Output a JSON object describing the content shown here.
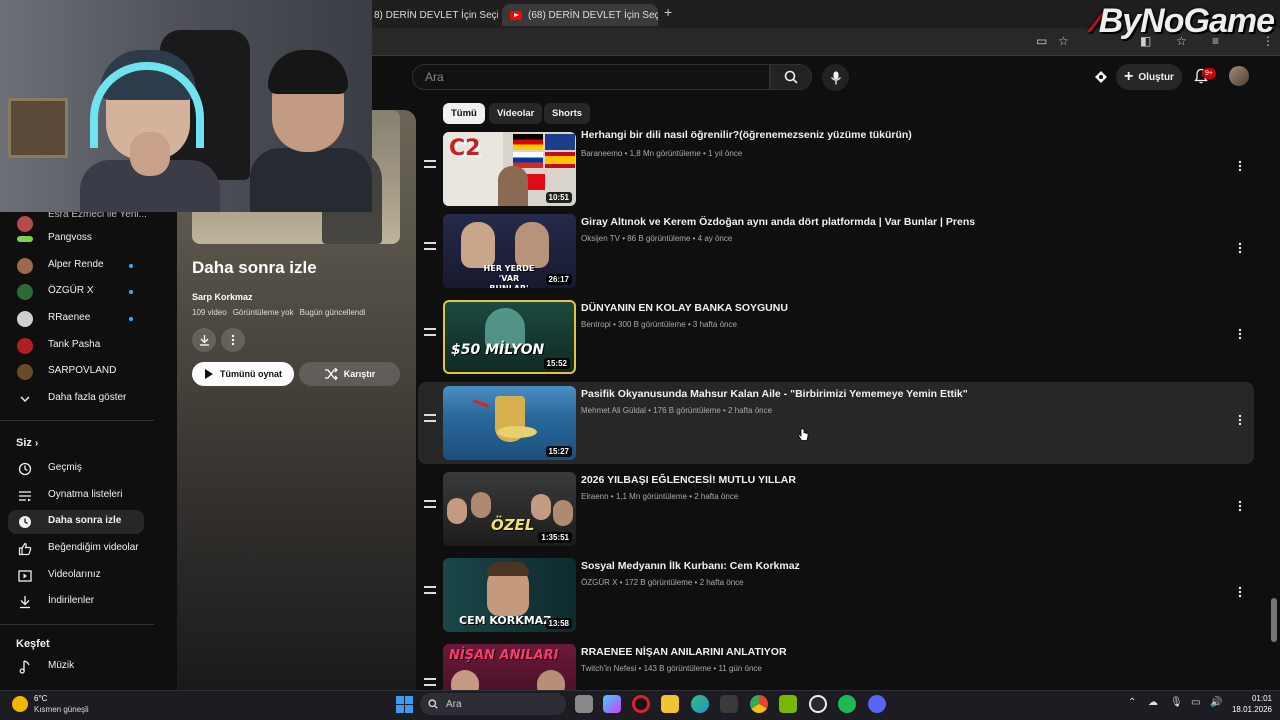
{
  "browser": {
    "tabs": [
      {
        "title": "8) DERİN DEVLET İçin Seçilse",
        "close": "✕"
      },
      {
        "title": "(68) DERİN DEVLET İçin Seçilse",
        "close": "✕"
      }
    ],
    "new_tab": "+"
  },
  "watermark": {
    "prefix": "By",
    "name": "NoGame"
  },
  "header": {
    "search_placeholder": "Ara",
    "create_label": "Oluştur",
    "notifications_count": "9+"
  },
  "sidebar": {
    "subscriptions": [
      {
        "label": "Esra Ezmeci ile Yeni...",
        "color": "#b84a4a",
        "dot": false
      },
      {
        "label": "Pangvoss",
        "color": "#7fd14a",
        "dot": false
      },
      {
        "label": "Alper Rende",
        "color": "#9a6a4a",
        "dot": true
      },
      {
        "label": "ÖZGÜR X",
        "color": "#2b6b3a",
        "dot": true
      },
      {
        "label": "RRaenee",
        "color": "#cfcfcf",
        "dot": true
      },
      {
        "label": "Tank Pasha",
        "color": "#b02020",
        "dot": false
      },
      {
        "label": "SARPOVLAND",
        "color": "#6b4a2a",
        "dot": false
      }
    ],
    "show_more": "Daha fazla göster",
    "you_header": "Siz",
    "you_items": [
      {
        "label": "Geçmiş",
        "icon": "history-icon"
      },
      {
        "label": "Oynatma listeleri",
        "icon": "playlists-icon"
      },
      {
        "label": "Daha sonra izle",
        "icon": "watch-later-icon"
      },
      {
        "label": "Beğendiğim videolar",
        "icon": "thumbs-up-icon"
      },
      {
        "label": "Videolarınız",
        "icon": "your-videos-icon"
      },
      {
        "label": "İndirilenler",
        "icon": "downloads-icon"
      }
    ],
    "explore_header": "Keşfet",
    "explore_items": [
      {
        "label": "Müzik",
        "icon": "music-icon"
      }
    ]
  },
  "playlist": {
    "title": "Daha sonra izle",
    "owner": "Sarp Korkmaz",
    "video_count": "109 video",
    "views": "Görüntüleme yok",
    "updated": "Bugün güncellendi",
    "play_all": "Tümünü oynat",
    "shuffle": "Karıştır"
  },
  "filters": [
    "Tümü",
    "Videolar",
    "Shorts"
  ],
  "videos": [
    {
      "title": "Herhangi bir dili nasıl öğrenilir?(öğrenemezseniz yüzüme tükürün)",
      "channel": "Baraneemo",
      "views": "1,8 Mn görüntüleme",
      "age": "1 yıl önce",
      "duration": "10:51",
      "thumb_text": "C2"
    },
    {
      "title": "Giray Altınok ve Kerem Özdoğan aynı anda dört platformda | Var Bunlar | Prens",
      "channel": "Oksijen TV",
      "views": "86 B görüntüleme",
      "age": "4 ay önce",
      "duration": "26:17",
      "thumb_text": "HER YERDE 'VAR BUNLAR'"
    },
    {
      "title": "DÜNYANIN EN KOLAY BANKA SOYGUNU",
      "channel": "Bentropi",
      "views": "300 B görüntüleme",
      "age": "3 hafta önce",
      "duration": "15:52",
      "thumb_text": "$50 MİLYON"
    },
    {
      "title": "Pasifik Okyanusunda Mahsur Kalan Aile - \"Birbirimizi Yememeye Yemin Ettik\"",
      "channel": "Mehmet Ali Güldal",
      "views": "176 B görüntüleme",
      "age": "2 hafta önce",
      "duration": "15:27",
      "thumb_text": ""
    },
    {
      "title": "2026 YILBAŞI EĞLENCESİ! MUTLU YILLAR",
      "channel": "Elraenn",
      "views": "1,1 Mn görüntüleme",
      "age": "2 hafta önce",
      "duration": "1:35:51",
      "thumb_text": "ÖZEL"
    },
    {
      "title": "Sosyal Medyanın İlk Kurbanı: Cem Korkmaz",
      "channel": "ÖZGÜR X",
      "views": "172 B görüntüleme",
      "age": "2 hafta önce",
      "duration": "13:58",
      "thumb_text": "CEM KORKMAZ"
    },
    {
      "title": "RRAENEE NİŞAN ANILARINI ANLATIYOR",
      "channel": "Twitch'in Nefesi",
      "views": "143 B görüntüleme",
      "age": "11 gün önce",
      "duration": "",
      "thumb_text": "NİŞAN ANILARI"
    }
  ],
  "taskbar": {
    "temperature": "6°C",
    "weather": "Kısmen güneşli",
    "search": "Ara",
    "time": "01:01",
    "date": "18.01.2026"
  }
}
